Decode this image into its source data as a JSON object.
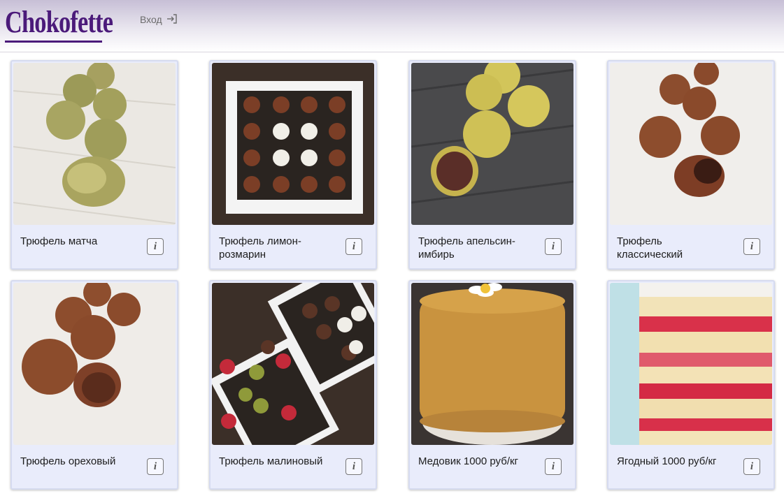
{
  "brand": {
    "logo_text": "Chokofette",
    "color": "#4b1a7a"
  },
  "nav": {
    "login_label": "Вход",
    "login_icon": "sign-in-icon"
  },
  "products": [
    {
      "title": "Трюфель матча",
      "info_label": "i",
      "image": "matcha-truffles-photo"
    },
    {
      "title": "Трюфель лимон-розмарин",
      "info_label": "i",
      "image": "lemon-rosemary-box-photo"
    },
    {
      "title": "Трюфель апельсин-имбирь",
      "info_label": "i",
      "image": "orange-ginger-truffles-photo"
    },
    {
      "title": "Трюфель классический",
      "info_label": "i",
      "image": "classic-truffles-photo"
    },
    {
      "title": "Трюфель ореховый",
      "info_label": "i",
      "image": "nut-truffles-photo"
    },
    {
      "title": "Трюфель малиновый",
      "info_label": "i",
      "image": "raspberry-truffle-boxes-photo"
    },
    {
      "title": "Медовик 1000 руб/кг",
      "info_label": "i",
      "image": "honey-cake-photo"
    },
    {
      "title": "Ягодный 1000 руб/кг",
      "info_label": "i",
      "image": "berry-cake-photo"
    }
  ]
}
